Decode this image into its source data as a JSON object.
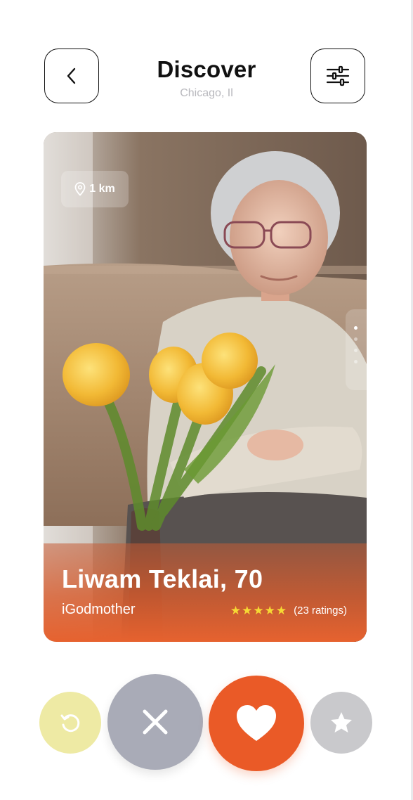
{
  "header": {
    "title": "Discover",
    "subtitle": "Chicago, Il",
    "back_icon": "chevron-left-icon",
    "filter_icon": "sliders-icon"
  },
  "card": {
    "distance": "1 km",
    "name": "Liwam Teklai, 70",
    "role": "iGodmother",
    "rating_stars": 5,
    "rating_count": "(23 ratings)",
    "photo_pages": 4,
    "active_photo_page": 1
  },
  "actions": {
    "undo_icon": "undo-icon",
    "nope_icon": "close-icon",
    "like_icon": "heart-icon",
    "super_icon": "star-icon"
  },
  "colors": {
    "accent": "#ea5a27",
    "undo": "#eeeaa4",
    "nope": "#a9abb7",
    "super": "#c9c9cc",
    "star": "#f6d934"
  }
}
